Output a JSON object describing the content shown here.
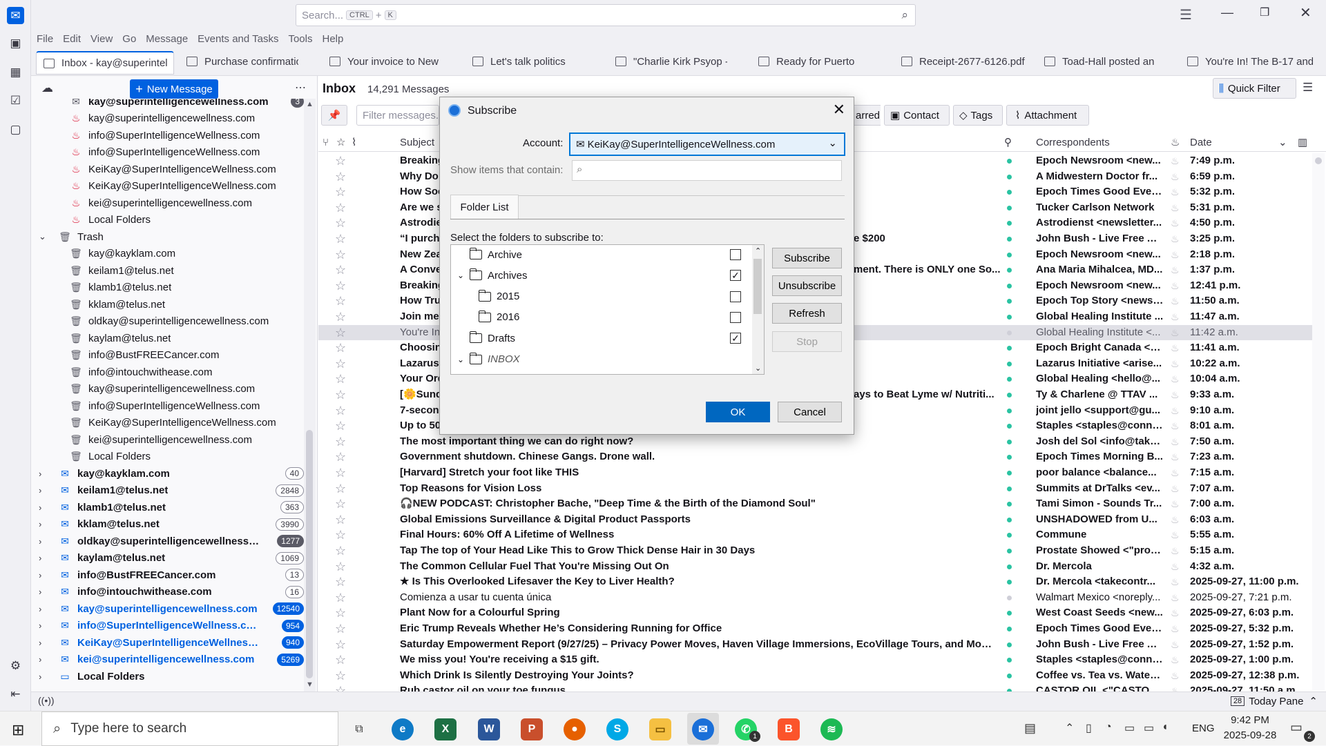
{
  "search": {
    "placeholder": "Search...",
    "kbd1": "CTRL",
    "plus": "+",
    "kbd2": "K"
  },
  "menu": [
    "File",
    "Edit",
    "View",
    "Go",
    "Message",
    "Events and Tasks",
    "Tools",
    "Help"
  ],
  "tabs": [
    {
      "label": "Inbox - kay@superintel"
    },
    {
      "label": "Purchase confirmation"
    },
    {
      "label": "Your invoice to New Ea"
    },
    {
      "label": "Let's talk politics"
    },
    {
      "label": "\"Charlie Kirk Psyop -- C"
    },
    {
      "label": "Ready for Puerto"
    },
    {
      "label": "Receipt-2677-6126.pdf"
    },
    {
      "label": "Toad-Hall posted an a"
    },
    {
      "label": "You're In! The B-17 and"
    }
  ],
  "folder_pane": {
    "new_message": "New Message",
    "more": "⋯",
    "first_row": {
      "label": "kay@superintelligencewellness.com",
      "count": "3"
    },
    "spam_items": [
      "kay@superintelligencewellness.com",
      "info@SuperIntelligenceWellness.com",
      "info@SuperIntelligenceWellness.com",
      "KeiKay@SuperIntelligenceWellness.com",
      "KeiKay@SuperIntelligenceWellness.com",
      "kei@superintelligencewellness.com",
      "Local Folders"
    ],
    "trash_label": "Trash",
    "trash_items": [
      "kay@kayklam.com",
      "keilam1@telus.net",
      "klamb1@telus.net",
      "kklam@telus.net",
      "oldkay@superintelligencewellness.com",
      "kaylam@telus.net",
      "info@BustFREECancer.com",
      "info@intouchwithease.com",
      "kay@superintelligencewellness.com",
      "info@SuperIntelligenceWellness.com",
      "KeiKay@SuperIntelligenceWellness.com",
      "kei@superintelligencewellness.com",
      "Local Folders"
    ],
    "accounts": [
      {
        "label": "kay@kayklam.com",
        "count": "40",
        "style": "grey",
        "blue": false
      },
      {
        "label": "keilam1@telus.net",
        "count": "2848",
        "style": "grey",
        "blue": false
      },
      {
        "label": "klamb1@telus.net",
        "count": "363",
        "style": "grey",
        "blue": false
      },
      {
        "label": "kklam@telus.net",
        "count": "3990",
        "style": "grey",
        "blue": false
      },
      {
        "label": "oldkay@superintelligencewellness.c...",
        "count": "1277",
        "style": "dark",
        "blue": false
      },
      {
        "label": "kaylam@telus.net",
        "count": "1069",
        "style": "grey",
        "blue": false
      },
      {
        "label": "info@BustFREECancer.com",
        "count": "13",
        "style": "grey",
        "blue": false
      },
      {
        "label": "info@intouchwithease.com",
        "count": "16",
        "style": "grey",
        "blue": false
      },
      {
        "label": "kay@superintelligencewellness.com",
        "count": "12540",
        "style": "blue",
        "blue": true
      },
      {
        "label": "info@SuperIntelligenceWellness.com",
        "count": "954",
        "style": "blue",
        "blue": true
      },
      {
        "label": "KeiKay@SuperIntelligenceWellness.c...",
        "count": "940",
        "style": "blue",
        "blue": true
      },
      {
        "label": "kei@superintelligencewellness.com",
        "count": "5269",
        "style": "blue",
        "blue": true
      },
      {
        "label": "Local Folders",
        "count": "",
        "style": "none",
        "blue": false
      }
    ]
  },
  "inbox": {
    "title": "Inbox",
    "count": "14,291 Messages",
    "quick_filter": "Quick Filter",
    "filter_placeholder": "Filter messages...",
    "starred": "arred",
    "contact": "Contact",
    "tags": "Tags",
    "attachment": "Attachment"
  },
  "columns": {
    "subject": "Subject",
    "correspondents": "Correspondents",
    "date": "Date"
  },
  "messages": [
    {
      "subject": "Breaking",
      "corr": "Epoch Newsroom <new...",
      "date": "7:49 p.m."
    },
    {
      "subject": "Why Do",
      "corr": "A Midwestern Doctor fr...",
      "date": "6:59 p.m."
    },
    {
      "subject": "How Soc",
      "corr": "Epoch Times Good Eveni...",
      "date": "5:32 p.m."
    },
    {
      "subject": "Are we s",
      "corr": "Tucker Carlson Network",
      "date": "5:31 p.m."
    },
    {
      "subject": "Astrodie",
      "corr": "Astrodienst <newsletter...",
      "date": "4:50 p.m."
    },
    {
      "subject": "“I purch",
      "tail": "e $200",
      "corr": "John Bush - Live Free Ac...",
      "date": "3:25 p.m."
    },
    {
      "subject": "New Zea",
      "corr": "Epoch Newsroom <new...",
      "date": "2:18 p.m."
    },
    {
      "subject": "A Conve",
      "tail": "ment. There is ONLY one So...",
      "corr": "Ana Maria Mihalcea, MD...",
      "date": "1:37 p.m."
    },
    {
      "subject": "Breaking",
      "corr": "Epoch Newsroom <new...",
      "date": "12:41 p.m."
    },
    {
      "subject": "How Tru",
      "corr": "Epoch Top Story <newsl...",
      "date": "11:50 a.m."
    },
    {
      "subject": "Join me",
      "corr": "Global Healing Institute ...",
      "date": "11:47 a.m."
    },
    {
      "subject": "You're In",
      "corr": "Global Healing Institute <...",
      "date": "11:42 a.m.",
      "sel": true,
      "nb": true
    },
    {
      "subject": "Choosin",
      "corr": "Epoch Bright Canada <n...",
      "date": "11:41 a.m."
    },
    {
      "subject": "Lazarus",
      "corr": "Lazarus Initiative <arise...",
      "date": "10:22 a.m."
    },
    {
      "subject": "Your Ord",
      "corr": "Global Healing <hello@...",
      "date": "10:04 a.m."
    },
    {
      "subject": "[🌼Sund",
      "tail": "ays to Beat Lyme w/ Nutriti...",
      "corr": "Ty & Charlene @ TTAV ...",
      "date": "9:33 a.m."
    },
    {
      "subject": "7-secon",
      "corr": "joint jello <support@gu...",
      "date": "9:10 a.m."
    },
    {
      "subject": "Up to 50",
      "corr": "Staples <staples@conne...",
      "date": "8:01 a.m."
    },
    {
      "subject": "The most important thing we can do right now?",
      "corr": "Josh del Sol <info@take...",
      "date": "7:50 a.m."
    },
    {
      "subject": "Government shutdown. Chinese Gangs. Drone wall.",
      "corr": "Epoch Times Morning B...",
      "date": "7:23 a.m."
    },
    {
      "subject": "[Harvard] Stretch your foot like THIS",
      "corr": "poor balance <balance...",
      "date": "7:15 a.m."
    },
    {
      "subject": "Top Reasons for Vision Loss",
      "corr": "Summits at DrTalks <ev...",
      "date": "7:07 a.m."
    },
    {
      "subject": "🎧NEW PODCAST: Christopher Bache, \"Deep Time & the Birth of the Diamond Soul\"",
      "corr": "Tami Simon - Sounds Tr...",
      "date": "7:00 a.m."
    },
    {
      "subject": "Global Emissions Surveillance & Digital Product Passports",
      "corr": "UNSHADOWED from U...",
      "date": "6:03 a.m."
    },
    {
      "subject": "Final Hours: 60% Off A Lifetime of Wellness",
      "corr": "Commune",
      "date": "5:55 a.m."
    },
    {
      "subject": "Tap The top of Your Head Like This to Grow Thick Dense Hair in 30 Days",
      "corr": "Prostate Showed <\"pros...",
      "date": "5:15 a.m."
    },
    {
      "subject": "The Common Cellular Fuel That You're Missing Out On",
      "corr": "Dr. Mercola",
      "date": "4:32 a.m."
    },
    {
      "subject": "★ Is This Overlooked Lifesaver the Key to Liver Health?",
      "corr": "Dr. Mercola <takecontr...",
      "date": "2025-09-27, 11:00 p.m."
    },
    {
      "subject": "Comienza a usar tu cuenta única",
      "corr": "Walmart Mexico <noreply...",
      "date": "2025-09-27, 7:21 p.m.",
      "nb": true
    },
    {
      "subject": "Plant Now for a Colourful Spring",
      "corr": "West Coast Seeds <new...",
      "date": "2025-09-27, 6:03 p.m."
    },
    {
      "subject": "Eric Trump Reveals Whether He’s Considering Running for Office",
      "corr": "Epoch Times Good Eveni...",
      "date": "2025-09-27, 5:32 p.m."
    },
    {
      "subject": "Saturday Empowerment Report (9/27/25) – Privacy Power Moves, Haven Village Immersions, EcoVillage Tours, and More...",
      "corr": "John Bush - Live Free Ac...",
      "date": "2025-09-27, 1:52 p.m."
    },
    {
      "subject": "We miss you! You're receiving a $15 gift.",
      "corr": "Staples <staples@conne...",
      "date": "2025-09-27, 1:00 p.m."
    },
    {
      "subject": "Which Drink Is Silently Destroying Your Joints?",
      "corr": "Coffee vs. Tea vs. Water ...",
      "date": "2025-09-27, 12:38 p.m."
    },
    {
      "subject": "Rub castor oil on your toe fungus",
      "corr": "CASTOR OIL <\"CASTOR...",
      "date": "2025-09-27, 11:50 a.m."
    }
  ],
  "dialog": {
    "title": "Subscribe",
    "account_label": "Account:",
    "account_value": "KeiKay@SuperIntelligenceWellness.com",
    "show_label": "Show items that contain:",
    "tab": "Folder List",
    "instructions": "Select the folders to subscribe to:",
    "folders": [
      {
        "name": "Archive",
        "checked": false,
        "indent": 0,
        "twisty": ""
      },
      {
        "name": "Archives",
        "checked": true,
        "indent": 0,
        "twisty": "v"
      },
      {
        "name": "2015",
        "checked": false,
        "indent": 1,
        "twisty": ""
      },
      {
        "name": "2016",
        "checked": false,
        "indent": 1,
        "twisty": ""
      },
      {
        "name": "Drafts",
        "checked": true,
        "indent": 0,
        "twisty": ""
      },
      {
        "name": "INBOX",
        "checked": false,
        "indent": 0,
        "twisty": "v",
        "italic": true
      }
    ],
    "btn_subscribe": "Subscribe",
    "btn_unsubscribe": "Unsubscribe",
    "btn_refresh": "Refresh",
    "btn_stop": "Stop",
    "btn_ok": "OK",
    "btn_cancel": "Cancel"
  },
  "statusbar": {
    "today_pane": "Today Pane",
    "cal_day": "28"
  },
  "taskbar": {
    "search": "Type here to search",
    "time": "9:42 PM",
    "date": "2025-09-28",
    "lang": "ENG",
    "notif": "2",
    "whatsapp_badge": "1"
  },
  "colors": {
    "accent": "#0061e0",
    "unread_dot": "#2ac3a2"
  }
}
